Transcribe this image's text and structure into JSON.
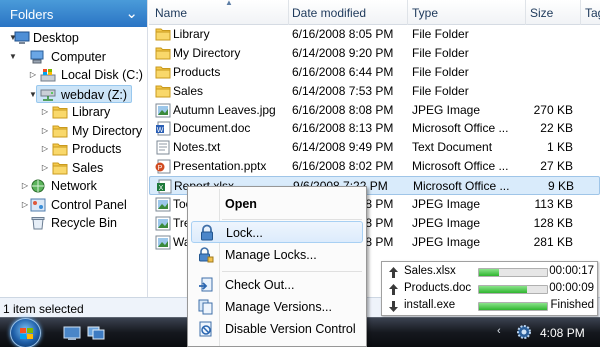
{
  "folders_header": {
    "title": "Folders"
  },
  "tree": [
    {
      "label": "Desktop",
      "icon": "desktop-icon",
      "twisty": "▼",
      "selected": false
    },
    {
      "label": "Computer",
      "icon": "computer-icon",
      "twisty": "▼",
      "selected": false
    },
    {
      "label": "Local Disk (C:)",
      "icon": "drive-icon",
      "twisty": "▷",
      "selected": false
    },
    {
      "label": "webdav (Z:)",
      "icon": "network-drive-icon",
      "twisty": "▼",
      "selected": true
    },
    {
      "label": "Library",
      "icon": "folder-icon",
      "twisty": "▷",
      "selected": false
    },
    {
      "label": "My Directory",
      "icon": "folder-icon",
      "twisty": "▷",
      "selected": false
    },
    {
      "label": "Products",
      "icon": "folder-icon",
      "twisty": "▷",
      "selected": false
    },
    {
      "label": "Sales",
      "icon": "folder-icon",
      "twisty": "▷",
      "selected": false
    },
    {
      "label": "Network",
      "icon": "network-icon",
      "twisty": "▷",
      "selected": false
    },
    {
      "label": "Control Panel",
      "icon": "control-panel-icon",
      "twisty": "▷",
      "selected": false
    },
    {
      "label": "Recycle Bin",
      "icon": "recycle-bin-icon",
      "twisty": "",
      "selected": false
    }
  ],
  "columns": {
    "name": "Name",
    "date": "Date modified",
    "type": "Type",
    "size": "Size",
    "tags": "Tag"
  },
  "files": [
    {
      "name": "Library",
      "date": "6/16/2008 8:05 PM",
      "type": "File Folder",
      "size": "",
      "icon": "folder-icon",
      "selected": false
    },
    {
      "name": "My Directory",
      "date": "6/14/2008 9:20 PM",
      "type": "File Folder",
      "size": "",
      "icon": "folder-icon",
      "selected": false
    },
    {
      "name": "Products",
      "date": "6/16/2008 6:44 PM",
      "type": "File Folder",
      "size": "",
      "icon": "folder-icon",
      "selected": false
    },
    {
      "name": "Sales",
      "date": "6/14/2008 7:53 PM",
      "type": "File Folder",
      "size": "",
      "icon": "folder-icon",
      "selected": false
    },
    {
      "name": "Autumn Leaves.jpg",
      "date": "6/16/2008 8:08 PM",
      "type": "JPEG Image",
      "size": "270 KB",
      "icon": "image-file-icon",
      "selected": false
    },
    {
      "name": "Document.doc",
      "date": "6/16/2008 8:13 PM",
      "type": "Microsoft Office ...",
      "size": "22 KB",
      "icon": "word-doc-icon",
      "selected": false
    },
    {
      "name": "Notes.txt",
      "date": "6/14/2008 9:49 PM",
      "type": "Text Document",
      "size": "1 KB",
      "icon": "text-file-icon",
      "selected": false
    },
    {
      "name": "Presentation.pptx",
      "date": "6/16/2008 8:02 PM",
      "type": "Microsoft Office ...",
      "size": "27 KB",
      "icon": "powerpoint-icon",
      "selected": false
    },
    {
      "name": "Report.xlsx",
      "date": "9/6/2008 7:22 PM",
      "type": "Microsoft Office ...",
      "size": "9 KB",
      "icon": "excel-icon",
      "selected": true
    },
    {
      "name": "Toolbox.jpg",
      "date": "6/16/2008 8:08 PM",
      "type": "JPEG Image",
      "size": "113 KB",
      "icon": "image-file-icon",
      "selected": false
    },
    {
      "name": "Tree.jpg",
      "date": "6/16/2008 8:08 PM",
      "type": "JPEG Image",
      "size": "128 KB",
      "icon": "image-file-icon",
      "selected": false
    },
    {
      "name": "Waterfall.jpg",
      "date": "6/16/2008 8:08 PM",
      "type": "JPEG Image",
      "size": "281 KB",
      "icon": "image-file-icon",
      "selected": false
    }
  ],
  "context_menu": {
    "open": "Open",
    "lock": "Lock...",
    "manage_locks": "Manage Locks...",
    "check_out": "Check Out...",
    "manage_versions": "Manage Versions...",
    "disable_version_control": "Disable Version Control"
  },
  "transfers": [
    {
      "name": "Sales.xlsx",
      "status": "00:00:17",
      "progress": 0.3,
      "icon": "upload-arrow-icon"
    },
    {
      "name": "Products.doc",
      "status": "00:00:09",
      "progress": 0.7,
      "icon": "upload-arrow-icon"
    },
    {
      "name": "install.exe",
      "status": "Finished",
      "progress": 1.0,
      "icon": "download-arrow-icon"
    }
  ],
  "status_bar": {
    "text": "1 item selected"
  },
  "taskbar": {
    "clock": "4:08 PM"
  }
}
